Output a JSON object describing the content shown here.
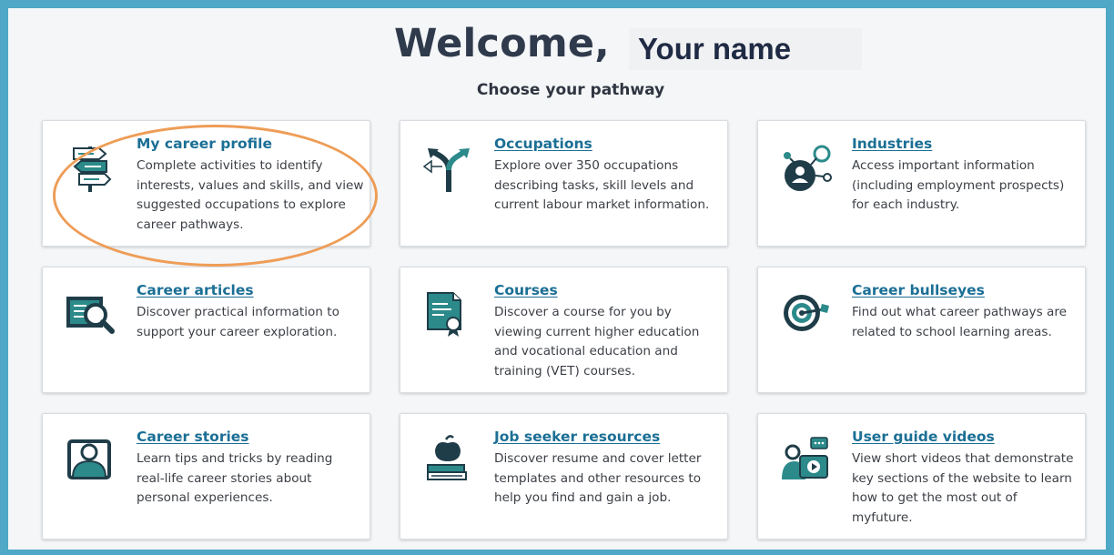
{
  "header": {
    "welcome": "Welcome,",
    "name": "Your name",
    "subtitle": "Choose your pathway"
  },
  "colors": {
    "frame": "#4ea8c6",
    "link": "#1b6f95",
    "icon_teal": "#2c8a8a",
    "icon_dark": "#1f3d48",
    "highlight_oval": "#ee9d57"
  },
  "cards": [
    {
      "title": "My career profile",
      "desc": "Complete activities to identify interests, values and skills, and view suggested occupations to explore career pathways.",
      "icon": "signpost-icon"
    },
    {
      "title": "Occupations",
      "desc": "Explore over 350 occupations describing tasks, skill levels and current labour market information.",
      "icon": "split-arrows-icon"
    },
    {
      "title": "Industries",
      "desc": "Access important information (including employment prospects) for each industry.",
      "icon": "network-person-icon"
    },
    {
      "title": "Career articles",
      "desc": "Discover practical information to support your career exploration.",
      "icon": "article-magnifier-icon"
    },
    {
      "title": "Courses",
      "desc": "Discover a course for you by viewing current higher education and vocational education and training (VET) courses.",
      "icon": "certificate-icon"
    },
    {
      "title": "Career bullseyes",
      "desc": "Find out what career pathways are related to school learning areas.",
      "icon": "bullseye-target-icon"
    },
    {
      "title": "Career stories",
      "desc": "Learn tips and tricks by reading real-life career stories about personal experiences.",
      "icon": "person-frame-icon"
    },
    {
      "title": "Job seeker resources",
      "desc": "Discover resume and cover letter templates and other resources to help you find and gain a job.",
      "icon": "apple-books-icon"
    },
    {
      "title": "User guide videos",
      "desc": "View short videos that demonstrate key sections of the website to learn how to get the most out of myfuture.",
      "icon": "video-guide-icon"
    }
  ]
}
